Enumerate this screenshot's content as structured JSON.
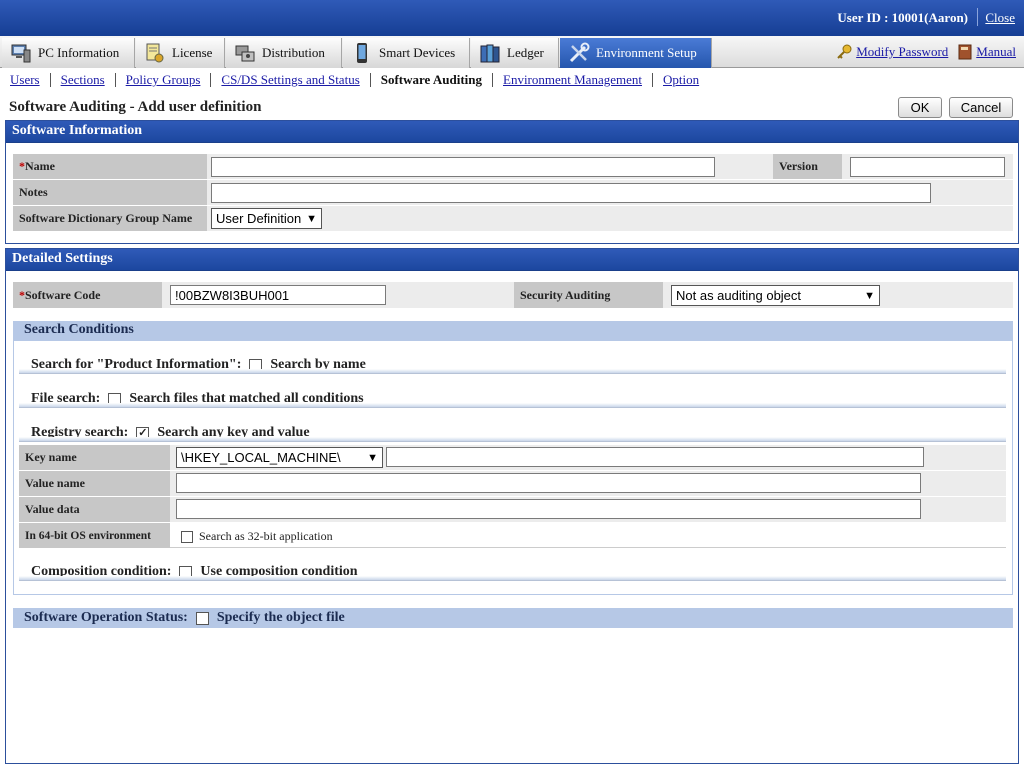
{
  "topbar": {
    "userid_label": "User ID : 10001(Aaron)",
    "close_label": "Close"
  },
  "tabs": [
    {
      "label": "PC Information",
      "icon": "pc-icon"
    },
    {
      "label": "License",
      "icon": "license-icon"
    },
    {
      "label": "Distribution",
      "icon": "distribution-icon"
    },
    {
      "label": "Smart Devices",
      "icon": "smartphone-icon"
    },
    {
      "label": "Ledger",
      "icon": "ledger-icon"
    },
    {
      "label": "Environment Setup",
      "icon": "tools-icon",
      "active": true
    }
  ],
  "right_links": {
    "modify_password": "Modify Password",
    "manual": "Manual"
  },
  "subnav": {
    "users": "Users",
    "sections": "Sections",
    "policy_groups": "Policy Groups",
    "csds": "CS/DS Settings and Status",
    "software_auditing": "Software Auditing",
    "env_mgmt": "Environment Management",
    "option": "Option"
  },
  "page": {
    "title": "Software Auditing - Add user definition",
    "ok_label": "OK",
    "cancel_label": "Cancel"
  },
  "software_info": {
    "header": "Software Information",
    "required_mark": "*",
    "name_label": "Name",
    "name_value": "",
    "version_label": "Version",
    "version_value": "",
    "notes_label": "Notes",
    "notes_value": "",
    "dict_group_label": "Software Dictionary Group Name",
    "dict_group_value": "User Definition"
  },
  "detailed": {
    "header": "Detailed Settings",
    "required_mark": "*",
    "code_label": "Software Code",
    "code_value": "!00BZW8I3BUH001",
    "security_label": "Security Auditing",
    "security_value": "Not as auditing object"
  },
  "search": {
    "header": "Search Conditions",
    "product_label": "Search for \"Product Information\":",
    "product_cb_label": "Search by name",
    "product_checked": false,
    "file_label": "File search:",
    "file_cb_label": "Search files that matched all conditions",
    "file_checked": false,
    "registry_label": "Registry search:",
    "registry_cb_label": "Search any key and value",
    "registry_checked": true,
    "check_mark": "✓",
    "key_name_label": "Key name",
    "key_root_value": "\\HKEY_LOCAL_MACHINE\\",
    "key_path_value": "",
    "value_name_label": "Value name",
    "value_name_value": "",
    "value_data_label": "Value data",
    "value_data_value": "",
    "os64_label": "In 64-bit OS environment",
    "os64_cb_label": "Search as 32-bit application",
    "os64_checked": false,
    "composition_label": "Composition condition:",
    "composition_cb_label": "Use composition condition",
    "composition_checked": false
  },
  "operation": {
    "label": "Software Operation Status:",
    "cb_label": "Specify the object file",
    "checked": false
  },
  "colors": {
    "header_blue": "#1c479f",
    "active_tab": "#2556ad",
    "subhead": "#b6c8e6",
    "label_bg": "#c7c7c7",
    "link": "#1a1aa6"
  }
}
